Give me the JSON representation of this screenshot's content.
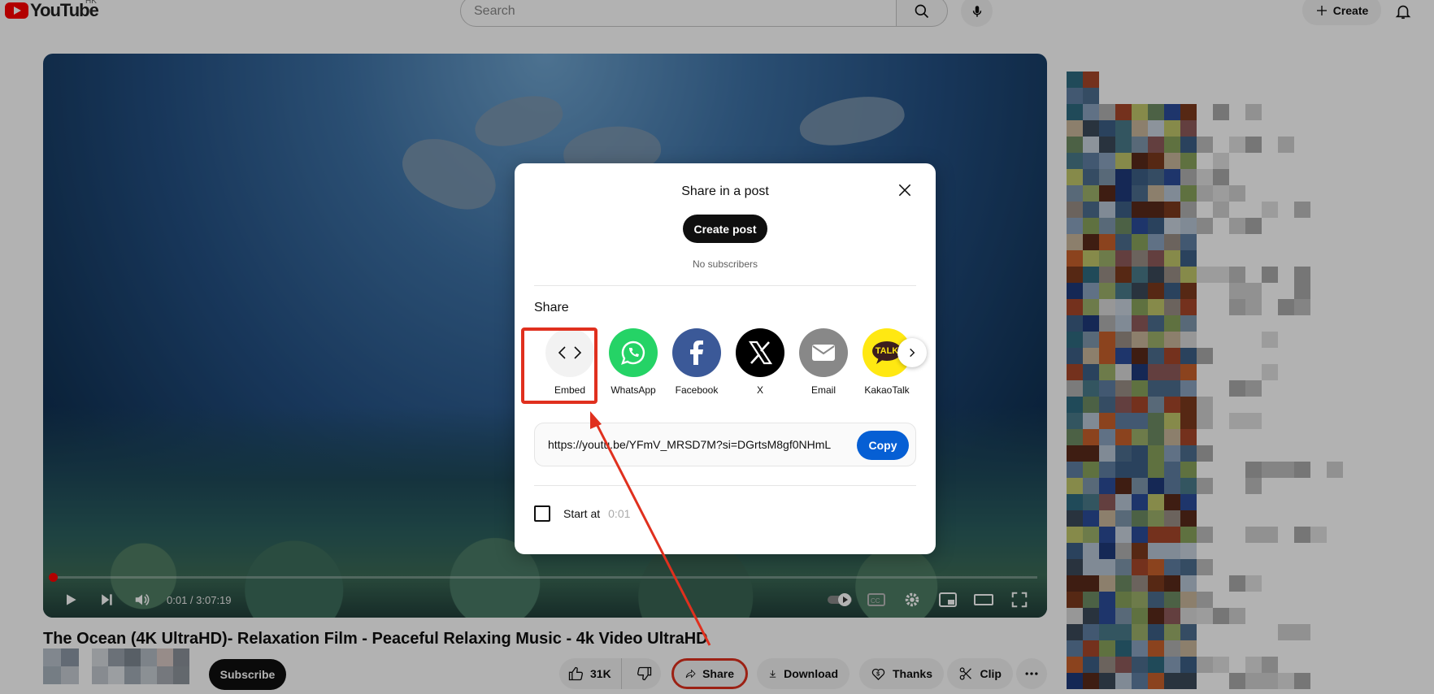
{
  "header": {
    "logo_text": "YouTube",
    "region": "HK",
    "search_placeholder": "Search",
    "create_label": "Create"
  },
  "player": {
    "time_display": "0:01 / 3:07:19",
    "progress": 0.0001
  },
  "share_dialog": {
    "title": "Share in a post",
    "create_post_label": "Create post",
    "subscribers_text": "No subscribers",
    "share_heading": "Share",
    "targets": [
      {
        "label": "Embed",
        "color": "#f2f2f2",
        "icon": "embed-icon"
      },
      {
        "label": "WhatsApp",
        "color": "#25d366",
        "icon": "whatsapp-icon"
      },
      {
        "label": "Facebook",
        "color": "#3b5998",
        "icon": "facebook-icon"
      },
      {
        "label": "X",
        "color": "#000000",
        "icon": "x-icon"
      },
      {
        "label": "Email",
        "color": "#888888",
        "icon": "email-icon"
      },
      {
        "label": "KakaoTalk",
        "color": "#ffe812",
        "icon": "kakaotalk-icon"
      }
    ],
    "kakao_icon_text": "TALK",
    "url": "https://youtu.be/YFmV_MRSD7M?si=DGrtsM8gf0NHmL",
    "copy_label": "Copy",
    "start_at_label": "Start at",
    "start_at_time": "0:01"
  },
  "video": {
    "title": "The Ocean (4K UltraHD)- Relaxation Film - Peaceful Relaxing Music - 4k Video UltraHD",
    "subscribe_label": "Subscribe",
    "like_count": "31K",
    "share_label": "Share",
    "download_label": "Download",
    "thanks_label": "Thanks",
    "clip_label": "Clip"
  },
  "colors": {
    "annotation": "#e0301e",
    "accent_blue": "#065fd4",
    "brand_red": "#ff0000"
  }
}
